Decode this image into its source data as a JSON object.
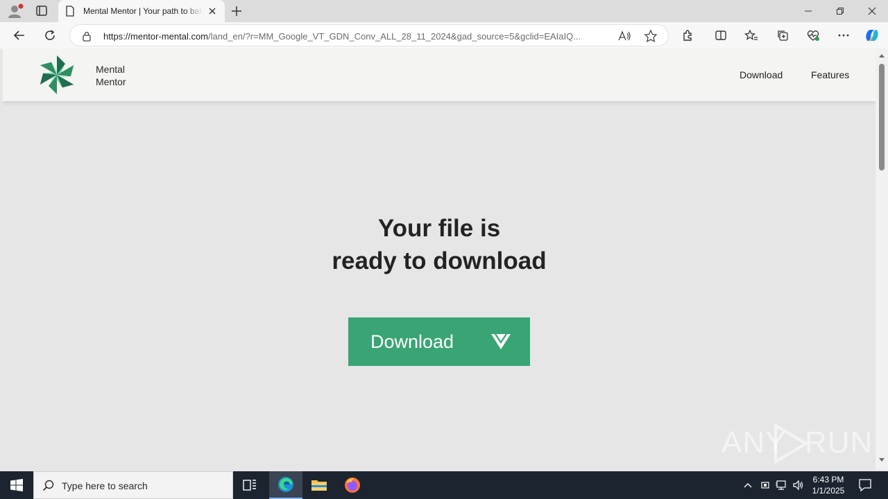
{
  "browser": {
    "tab": {
      "title": "Mental Mentor | Your path to balance"
    },
    "address": {
      "url_host": "https://mentor-mental.com",
      "url_path": "/land_en/?r=MM_Google_VT_GDN_Conv_ALL_28_11_2024&gad_source=5&gclid=EAIaIQ..."
    }
  },
  "site": {
    "brand_line1": "Mental",
    "brand_line2": "Mentor",
    "nav": {
      "download": "Download",
      "features": "Features"
    },
    "headline_line1": "Your file is",
    "headline_line2": "ready to download",
    "download_button": "Download",
    "accent_color": "#39a574"
  },
  "watermark": {
    "left": "ANY",
    "right": "RUN"
  },
  "taskbar": {
    "search_placeholder": "Type here to search",
    "time": "6:43 PM",
    "date": "1/1/2025"
  }
}
